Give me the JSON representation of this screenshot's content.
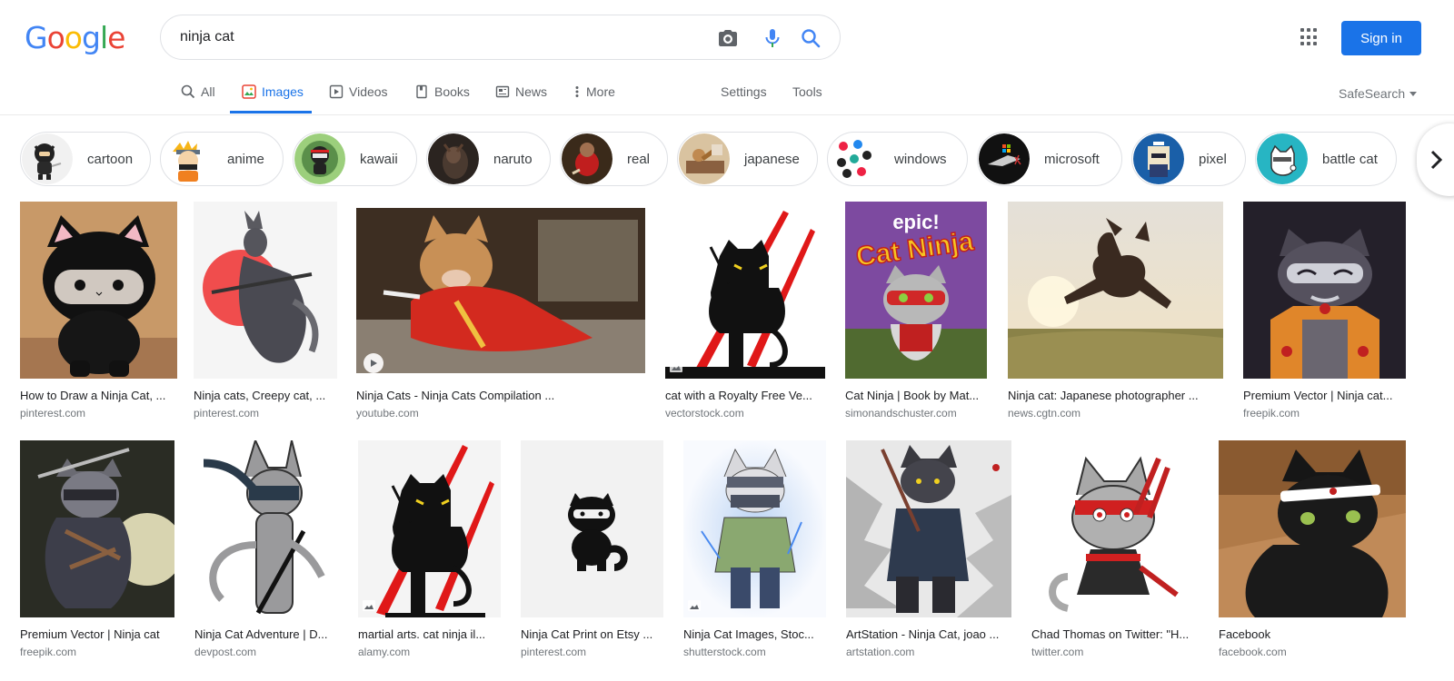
{
  "logo": {
    "text": "Google",
    "letters": [
      "G",
      "o",
      "o",
      "g",
      "l",
      "e"
    ],
    "colors": [
      "#4285f4",
      "#ea4335",
      "#fbbc05",
      "#4285f4",
      "#34a853",
      "#ea4335"
    ]
  },
  "search": {
    "query": "ninja cat",
    "icons": [
      "camera-icon",
      "microphone-icon",
      "search-icon"
    ]
  },
  "header": {
    "signin_label": "Sign in",
    "accent": "#1a73e8"
  },
  "nav": {
    "tabs": [
      {
        "label": "All",
        "icon": "search-icon"
      },
      {
        "label": "Images",
        "icon": "image-icon",
        "active": true
      },
      {
        "label": "Videos",
        "icon": "video-icon"
      },
      {
        "label": "Books",
        "icon": "book-icon"
      },
      {
        "label": "News",
        "icon": "news-icon"
      },
      {
        "label": "More",
        "icon": "more-vert-icon"
      }
    ],
    "settings": "Settings",
    "tools": "Tools",
    "safesearch": "SafeSearch"
  },
  "chips": [
    {
      "label": "cartoon"
    },
    {
      "label": "anime"
    },
    {
      "label": "kawaii"
    },
    {
      "label": "naruto"
    },
    {
      "label": "real"
    },
    {
      "label": "japanese"
    },
    {
      "label": "windows"
    },
    {
      "label": "microsoft"
    },
    {
      "label": "pixel"
    },
    {
      "label": "battle cat"
    }
  ],
  "results": [
    {
      "title": "How to Draw a Ninja Cat, ...",
      "source": "pinterest.com"
    },
    {
      "title": "Ninja cats, Creepy cat, ...",
      "source": "pinterest.com"
    },
    {
      "title": "Ninja Cats - Ninja Cats Compilation ...",
      "source": "youtube.com"
    },
    {
      "title": "cat with a Royalty Free Ve...",
      "source": "vectorstock.com"
    },
    {
      "title": "Cat Ninja | Book by Mat...",
      "source": "simonandschuster.com"
    },
    {
      "title": "Ninja cat: Japanese photographer ...",
      "source": "news.cgtn.com"
    },
    {
      "title": "Premium Vector | Ninja cat...",
      "source": "freepik.com"
    },
    {
      "title": "Premium Vector | Ninja cat",
      "source": "freepik.com"
    },
    {
      "title": "Ninja Cat Adventure | D...",
      "source": "devpost.com"
    },
    {
      "title": "martial arts. cat ninja il...",
      "source": "alamy.com"
    },
    {
      "title": "Ninja Cat Print on Etsy ...",
      "source": "pinterest.com"
    },
    {
      "title": "Ninja Cat Images, Stoc...",
      "source": "shutterstock.com"
    },
    {
      "title": "ArtStation - Ninja Cat, joao ...",
      "source": "artstation.com"
    },
    {
      "title": "Chad Thomas on Twitter: \"H...",
      "source": "twitter.com"
    },
    {
      "title": "Facebook",
      "source": "facebook.com"
    }
  ],
  "image_text": {
    "epic_cover": "Cat Ninja",
    "epic_brand": "epic!"
  }
}
